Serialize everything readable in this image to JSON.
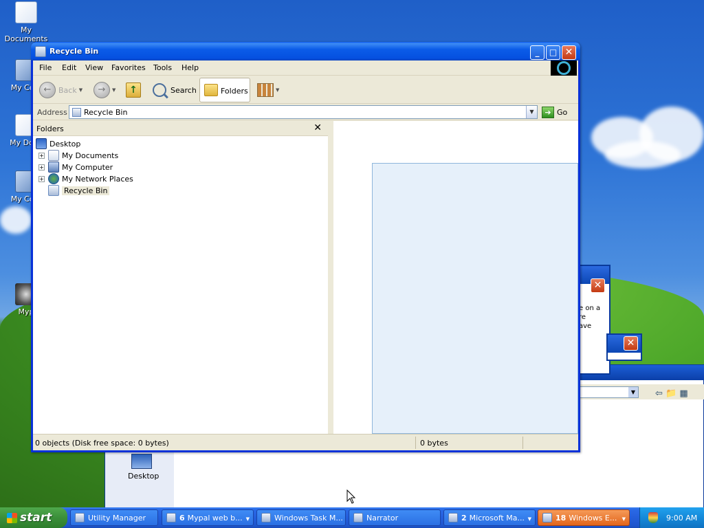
{
  "desktop": {
    "icons": [
      {
        "label": "My Documents"
      },
      {
        "label": "My Com"
      },
      {
        "label": "My Docu"
      },
      {
        "label": "My Com"
      },
      {
        "label": "Myp"
      }
    ],
    "background_window_item": "Desktop",
    "background_dialog_text": [
      "e on a",
      "re",
      "ave"
    ]
  },
  "window": {
    "title": "Recycle Bin",
    "controls": {
      "minimize": "_",
      "maximize": "□",
      "close": "✕"
    },
    "menu": [
      "File",
      "Edit",
      "View",
      "Favorites",
      "Tools",
      "Help"
    ],
    "toolbar": {
      "back_label": "Back",
      "search_label": "Search",
      "folders_label": "Folders"
    },
    "address": {
      "label": "Address",
      "value": "Recycle Bin",
      "go_label": "Go"
    },
    "folders_pane": {
      "title": "Folders",
      "close": "✕",
      "tree": [
        {
          "label": "Desktop",
          "expandable": false,
          "icon": "desktop-icon"
        },
        {
          "label": "My Documents",
          "expandable": true,
          "icon": "documents-icon"
        },
        {
          "label": "My Computer",
          "expandable": true,
          "icon": "computer-icon"
        },
        {
          "label": "My Network Places",
          "expandable": true,
          "icon": "network-icon"
        },
        {
          "label": "Recycle Bin",
          "expandable": false,
          "icon": "recycle-bin-icon",
          "selected": true
        }
      ]
    },
    "status": {
      "left": "0 objects (Disk free space: 0 bytes)",
      "right": "0 bytes"
    }
  },
  "taskbar": {
    "start_label": "start",
    "tasks": [
      {
        "count": "",
        "label": "Utility Manager",
        "active": false
      },
      {
        "count": "6",
        "label": "Mypal web b...",
        "active": false
      },
      {
        "count": "",
        "label": "Windows Task M...",
        "active": false
      },
      {
        "count": "",
        "label": "Narrator",
        "active": false
      },
      {
        "count": "2",
        "label": "Microsoft Ma...",
        "active": false
      },
      {
        "count": "18",
        "label": "Windows E...",
        "active": true
      }
    ],
    "clock": "9:00 AM"
  },
  "colors": {
    "titlebar": "#0a58f0",
    "taskbar": "#245edb",
    "start": "#3b8f3a",
    "active_task": "#e2651c",
    "selection_fill": "#e6f0fa"
  }
}
